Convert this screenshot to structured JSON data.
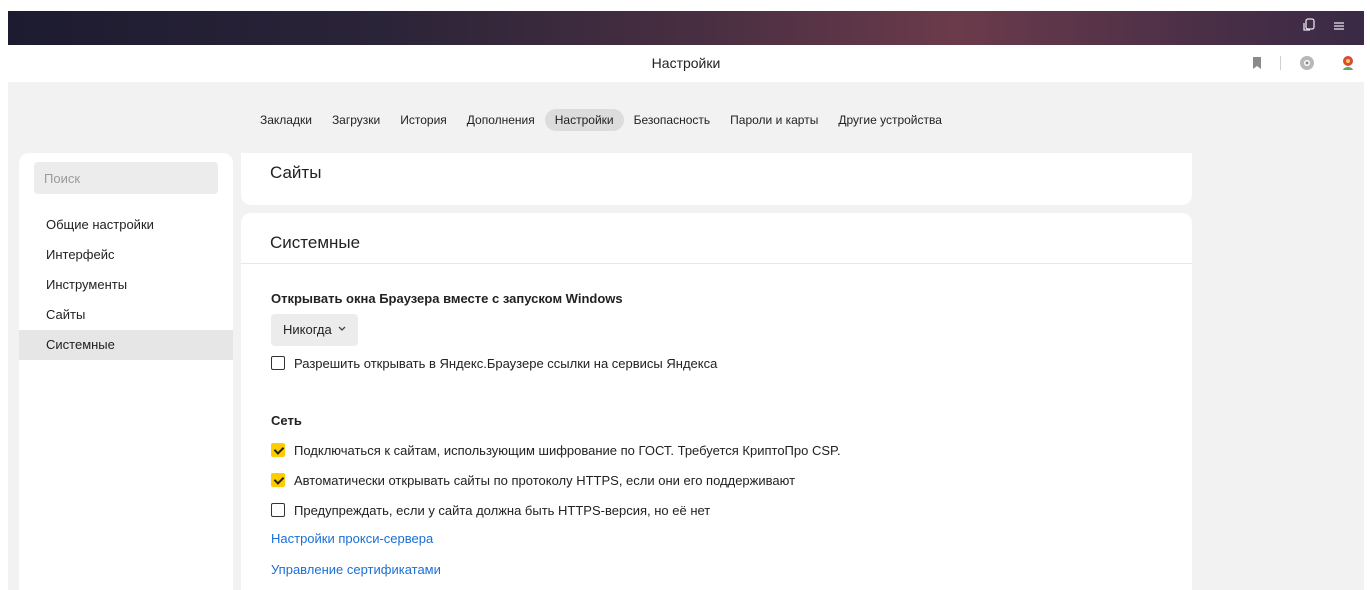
{
  "window": {
    "icons": [
      "tab-copy-icon",
      "menu-icon"
    ]
  },
  "address_bar": {
    "title": "Настройки",
    "icons": [
      "bookmark-icon",
      "extension-icon",
      "profile-icon"
    ]
  },
  "tabs": [
    {
      "label": "Закладки",
      "active": false
    },
    {
      "label": "Загрузки",
      "active": false
    },
    {
      "label": "История",
      "active": false
    },
    {
      "label": "Дополнения",
      "active": false
    },
    {
      "label": "Настройки",
      "active": true
    },
    {
      "label": "Безопасность",
      "active": false
    },
    {
      "label": "Пароли и карты",
      "active": false
    },
    {
      "label": "Другие устройства",
      "active": false
    }
  ],
  "sidebar": {
    "search_placeholder": "Поиск",
    "items": [
      {
        "label": "Общие настройки",
        "active": false
      },
      {
        "label": "Интерфейс",
        "active": false
      },
      {
        "label": "Инструменты",
        "active": false
      },
      {
        "label": "Сайты",
        "active": false
      },
      {
        "label": "Системные",
        "active": true
      }
    ]
  },
  "sites_card": {
    "title": "Сайты"
  },
  "system_card": {
    "title": "Системные",
    "startup_label": "Открывать окна Браузера вместе с запуском Windows",
    "startup_value": "Никогда",
    "allow_links_label": "Разрешить открывать в Яндекс.Браузере ссылки на сервисы Яндекса",
    "allow_links_checked": false,
    "network_label": "Сеть",
    "network_options": [
      {
        "label": "Подключаться к сайтам, использующим шифрование по ГОСТ. Требуется КриптоПро CSP.",
        "checked": true
      },
      {
        "label": "Автоматически открывать сайты по протоколу HTTPS, если они его поддерживают",
        "checked": true
      },
      {
        "label": "Предупреждать, если у сайта должна быть HTTPS-версия, но её нет",
        "checked": false
      }
    ],
    "proxy_link": "Настройки прокси-сервера",
    "certs_link": "Управление сертификатами"
  },
  "colors": {
    "accent": "#ffcc00",
    "link": "#1a6fd6"
  }
}
